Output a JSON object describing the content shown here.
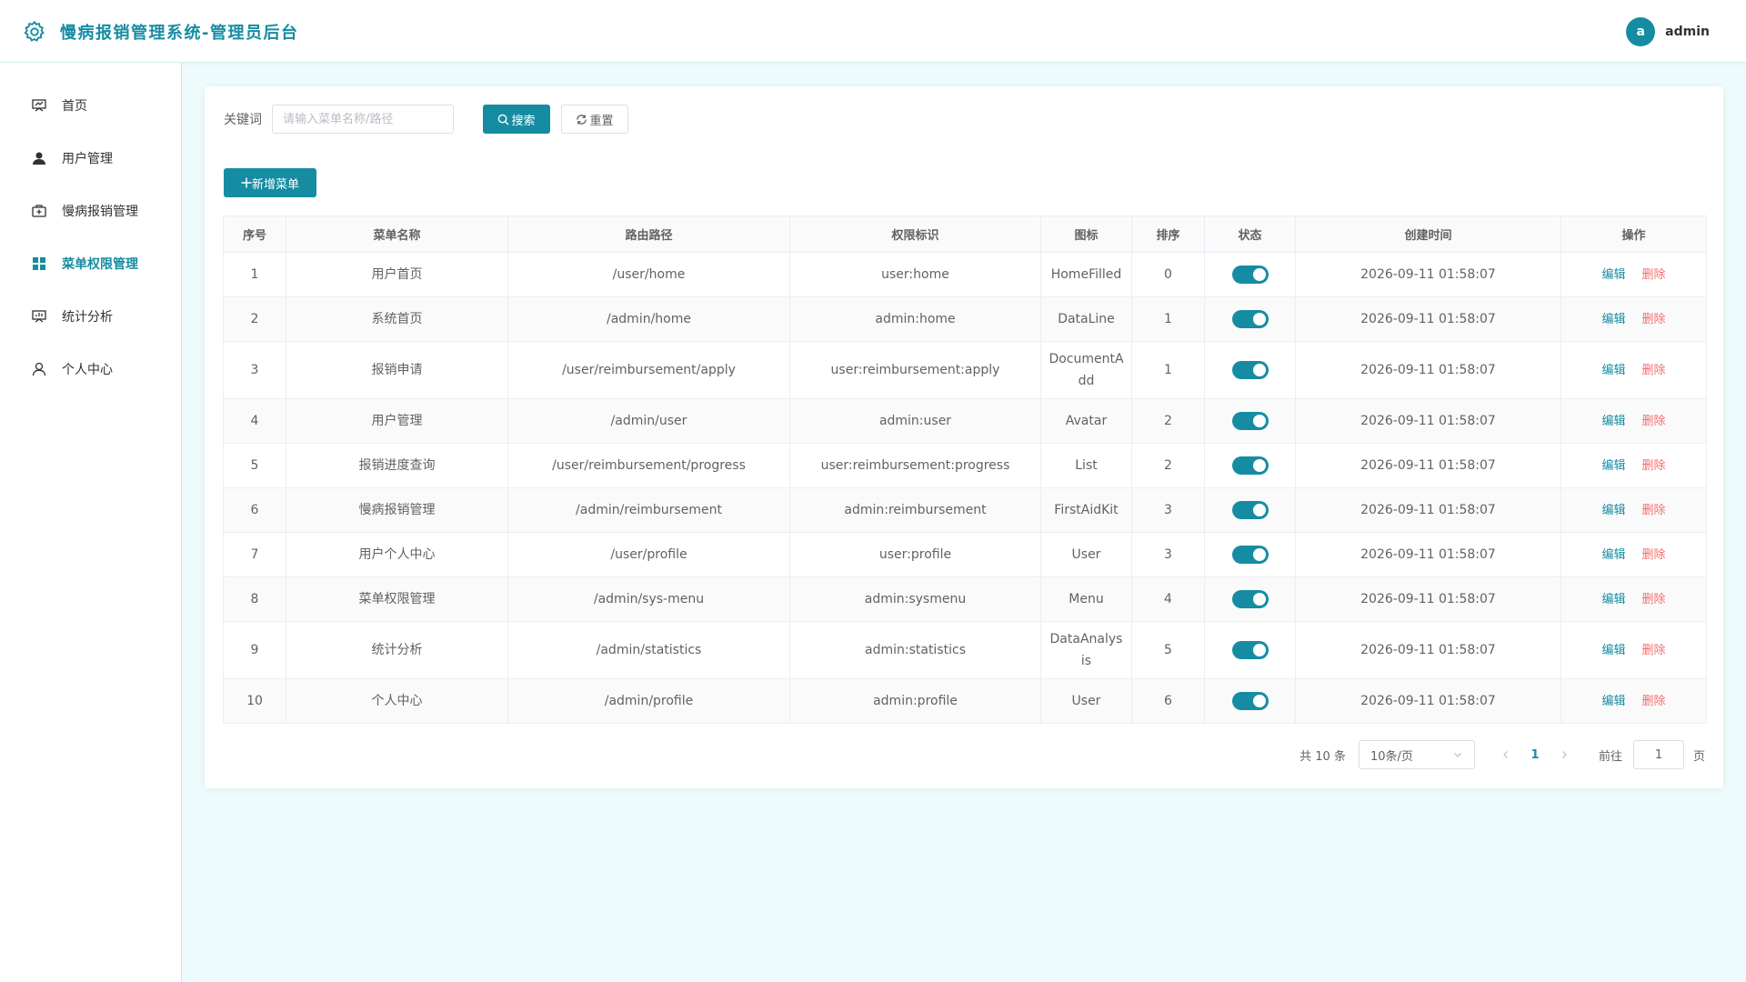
{
  "header": {
    "title": "慢病报销管理系统-管理员后台",
    "avatar_letter": "a",
    "username": "admin",
    "brand_color": "#168ca3"
  },
  "sidebar": {
    "items": [
      {
        "label": "首页",
        "icon": "presentation-icon",
        "active": false
      },
      {
        "label": "用户管理",
        "icon": "user-filled-icon",
        "active": false
      },
      {
        "label": "慢病报销管理",
        "icon": "first-aid-kit-icon",
        "active": false
      },
      {
        "label": "菜单权限管理",
        "icon": "grid-menu-icon",
        "active": true
      },
      {
        "label": "统计分析",
        "icon": "data-analysis-icon",
        "active": false
      },
      {
        "label": "个人中心",
        "icon": "user-icon",
        "active": false
      }
    ]
  },
  "search": {
    "label": "关键词",
    "placeholder": "请输入菜单名称/路径",
    "value": "",
    "search_button": "搜索",
    "reset_button": "重置"
  },
  "toolbar": {
    "add_button": "新增菜单"
  },
  "table": {
    "columns": [
      "序号",
      "菜单名称",
      "路由路径",
      "权限标识",
      "图标",
      "排序",
      "状态",
      "创建时间",
      "操作"
    ],
    "actions": {
      "edit": "编辑",
      "delete": "删除"
    },
    "rows": [
      {
        "index": "1",
        "name": "用户首页",
        "path": "/user/home",
        "perm": "user:home",
        "icon": "HomeFilled",
        "sort": "0",
        "enabled": true,
        "created": "2026-09-11 01:58:07"
      },
      {
        "index": "2",
        "name": "系统首页",
        "path": "/admin/home",
        "perm": "admin:home",
        "icon": "DataLine",
        "sort": "1",
        "enabled": true,
        "created": "2026-09-11 01:58:07"
      },
      {
        "index": "3",
        "name": "报销申请",
        "path": "/user/reimbursement/apply",
        "perm": "user:reimbursement:apply",
        "icon": "DocumentAdd",
        "sort": "1",
        "enabled": true,
        "created": "2026-09-11 01:58:07"
      },
      {
        "index": "4",
        "name": "用户管理",
        "path": "/admin/user",
        "perm": "admin:user",
        "icon": "Avatar",
        "sort": "2",
        "enabled": true,
        "created": "2026-09-11 01:58:07"
      },
      {
        "index": "5",
        "name": "报销进度查询",
        "path": "/user/reimbursement/progress",
        "perm": "user:reimbursement:progress",
        "icon": "List",
        "sort": "2",
        "enabled": true,
        "created": "2026-09-11 01:58:07"
      },
      {
        "index": "6",
        "name": "慢病报销管理",
        "path": "/admin/reimbursement",
        "perm": "admin:reimbursement",
        "icon": "FirstAidKit",
        "sort": "3",
        "enabled": true,
        "created": "2026-09-11 01:58:07"
      },
      {
        "index": "7",
        "name": "用户个人中心",
        "path": "/user/profile",
        "perm": "user:profile",
        "icon": "User",
        "sort": "3",
        "enabled": true,
        "created": "2026-09-11 01:58:07"
      },
      {
        "index": "8",
        "name": "菜单权限管理",
        "path": "/admin/sys-menu",
        "perm": "admin:sysmenu",
        "icon": "Menu",
        "sort": "4",
        "enabled": true,
        "created": "2026-09-11 01:58:07"
      },
      {
        "index": "9",
        "name": "统计分析",
        "path": "/admin/statistics",
        "perm": "admin:statistics",
        "icon": "DataAnalysis",
        "sort": "5",
        "enabled": true,
        "created": "2026-09-11 01:58:07"
      },
      {
        "index": "10",
        "name": "个人中心",
        "path": "/admin/profile",
        "perm": "admin:profile",
        "icon": "User",
        "sort": "6",
        "enabled": true,
        "created": "2026-09-11 01:58:07"
      }
    ]
  },
  "pagination": {
    "total_text": "共 10 条",
    "page_size": "10条/页",
    "current_page": "1",
    "goto_label": "前往",
    "goto_value": "1",
    "page_unit": "页"
  }
}
